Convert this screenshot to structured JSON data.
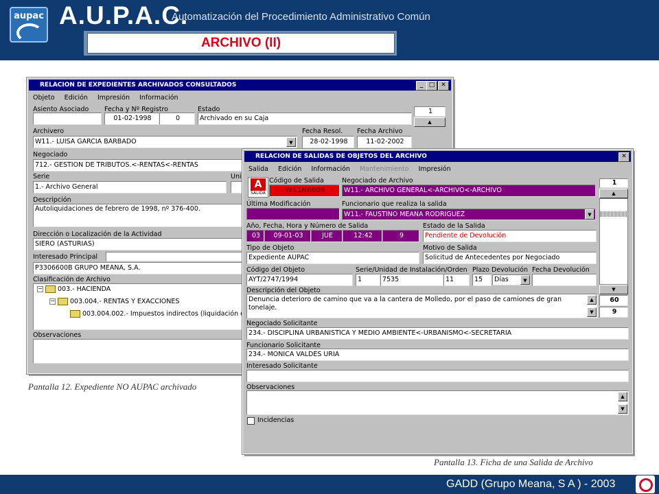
{
  "header": {
    "logo_text": "aupac",
    "title": "A.U.P.A.C.",
    "subtitle": "Automatización del Procedimiento Administrativo Común",
    "banner": "ARCHIVO (II)"
  },
  "footer": {
    "text": "GADD (Grupo Meana, S A ) - 2003"
  },
  "win1": {
    "title": "RELACION DE EXPEDIENTES ARCHIVADOS CONSULTADOS",
    "menu": [
      "Objeto",
      "Edición",
      "Impresión",
      "Información"
    ],
    "labels": {
      "asiento": "Asiento Asociado",
      "fecha_registro": "Fecha y Nº Registro",
      "estado": "Estado",
      "archivero": "Archivero",
      "fecha_resol": "Fecha Resol.",
      "fecha_archivo": "Fecha Archivo",
      "negociado": "Negociado",
      "serie": "Serie",
      "uni": "Uni",
      "descripcion": "Descripción",
      "direccion": "Dirección o Localización de la Actividad",
      "interesado": "Interesado Principal",
      "clasificacion": "Clasificación de Archivo",
      "observaciones": "Observaciones"
    },
    "values": {
      "asiento": "",
      "fecha": "01-02-1998",
      "numero": "0",
      "estado": "Archivado en su Caja",
      "archivero": "W11.- LUISA GARCIA BARBADO",
      "fecha_resol": "28-02-1998",
      "fecha_archivo": "11-02-2002",
      "negociado": "712.- GESTION DE TRIBUTOS.<-RENTAS<-RENTAS",
      "serie": "1.- Archivo General",
      "descripcion": "Autoliquidaciones de febrero de 1998, nº 376-400.",
      "direccion": "SIERO (ASTURIAS)",
      "interesado": "P3306600B GRUPO MEANA, S.A.",
      "counter": "1"
    },
    "tree": [
      "003.- HACIENDA",
      "003.004.- RENTAS Y EXACCIONES",
      "003.004.002.- Impuestos indirectos (liquidación c"
    ]
  },
  "caption1": "Pantalla 12. Expediente NO AUPAC archivado",
  "win2": {
    "title": "RELACION DE SALIDAS DE OBJETOS DEL ARCHIVO",
    "menu": [
      "Salida",
      "Edición",
      "Información",
      "Mantenimiento",
      "Impresión"
    ],
    "salida_label": "SALIDA",
    "labels": {
      "codigo_salida": "Código de Salida",
      "negociado_archivo": "Negociado de Archivo",
      "ultima_mod": "Última Modificación",
      "funcionario": "Funcionario que realiza la salida",
      "anio": "Año, Fecha, Hora y Número de Salida",
      "estado_salida": "Estado de la Salida",
      "tipo_objeto": "Tipo de Objeto",
      "motivo": "Motivo de Salida",
      "codigo_objeto": "Código del Objeto",
      "serie_unidad": "Serie/Unidad de Instalación/Orden",
      "plazo": "Plazo Devolución",
      "fecha_dev": "Fecha Devolución",
      "descripcion_objeto": "Descripción del Objeto",
      "neg_solicitante": "Negociado Solicitante",
      "func_solicitante": "Funcionario Solicitante",
      "int_solicitante": "Interesado Solicitante",
      "observaciones": "Observaciones",
      "incidencias": "Incidencias"
    },
    "values": {
      "codigo_salida": "W11N0009",
      "negociado_archivo": "W11.- ARCHIVO GENERAL<-ARCHIVO<-ARCHIVO",
      "ultima_mod": "",
      "funcionario": "W11.- FAUSTINO MEANA RODRIGUEZ",
      "anio": "03",
      "fecha": "09-01-03",
      "dia": "JUE",
      "hora": "12:42",
      "numero": "9",
      "estado_salida": "Pendiente de Devolución",
      "tipo_objeto": "Expediente AUPAC",
      "motivo": "Solicitud de Antecedentes por Negociado",
      "codigo_objeto": "AYT/2747/1994",
      "serie": "1",
      "unidad": "7535",
      "orden": "11",
      "plazo": "15",
      "plazo_unidad": "Días",
      "fecha_dev": "",
      "descripcion_objeto": "Denuncia deterioro de camino que va a la cantera de Molledo, por el paso de camiones de gran tonelaje.",
      "neg_solicitante": "234.- DISCIPLINA URBANISTICA Y MEDIO AMBIENTE<-URBANISMO<-SECRETARIA",
      "func_solicitante": "234.- MONICA VALDES URIA",
      "int_solicitante": "",
      "observaciones": "",
      "counter_top": "1",
      "counter_a": "60",
      "counter_b": "9"
    }
  },
  "caption2": "Pantalla 13. Ficha de una Salida de Archivo",
  "colors": {
    "header": "#0e3a6f",
    "title_bar": "#000080",
    "highlight": "#800080",
    "banner_text": "#e0001a"
  }
}
